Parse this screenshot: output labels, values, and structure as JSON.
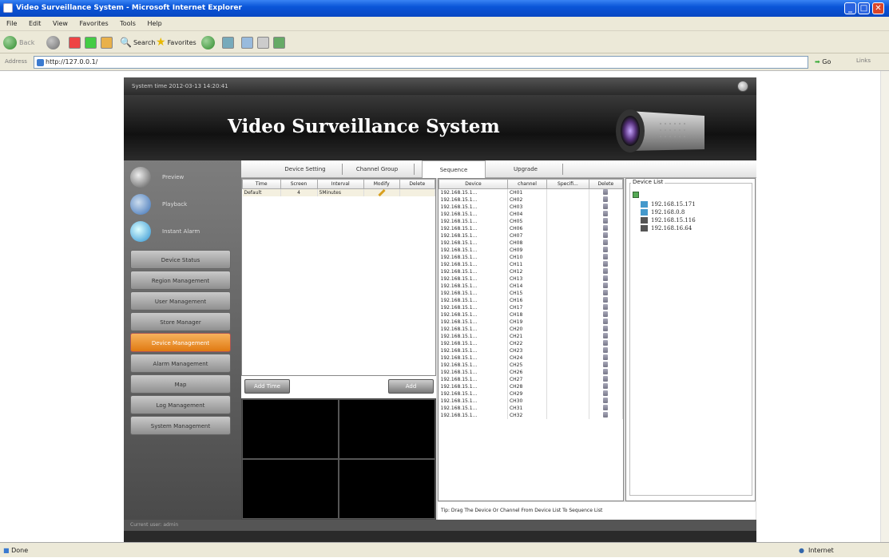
{
  "window": {
    "title": "Video Surveillance System - Microsoft Internet Explorer"
  },
  "menu": {
    "items": [
      "File",
      "Edit",
      "View",
      "Favorites",
      "Tools",
      "Help"
    ]
  },
  "toolbar": {
    "back": "Back",
    "search": "Search",
    "favorites": "Favorites"
  },
  "address": {
    "label": "Address",
    "url": "http://127.0.0.1/",
    "go": "Go",
    "links": "Links"
  },
  "status": {
    "left": "Done",
    "zone": "Internet"
  },
  "app": {
    "system_time": "System time 2012-03-13 14:20:41",
    "banner_title": "Video Surveillance System",
    "nav_top": [
      "Preview",
      "Playback",
      "Instant Alarm"
    ],
    "nav": [
      "Device Status",
      "Region Management",
      "User Management",
      "Store Manager",
      "Device Management",
      "Alarm Management",
      "Map",
      "Log Management",
      "System Management"
    ],
    "nav_active": "Device Management",
    "tabs": [
      "Device Setting",
      "Channel Group",
      "Sequence",
      "Upgrade"
    ],
    "active_tab": "Sequence",
    "seq_table": {
      "headers": [
        "Time",
        "Screen",
        "Interval",
        "Modify",
        "Delete"
      ],
      "rows": [
        [
          "Default",
          "4",
          "5Minutes"
        ]
      ]
    },
    "add_time_label": "Add Time",
    "add_label": "Add",
    "chan_table": {
      "headers": [
        "Device",
        "channel",
        "Specifi...",
        "Delete"
      ],
      "device": "192.168.15.1...",
      "channels": [
        "CH01",
        "CH02",
        "CH03",
        "CH04",
        "CH05",
        "CH06",
        "CH07",
        "CH08",
        "CH09",
        "CH10",
        "CH11",
        "CH12",
        "CH13",
        "CH14",
        "CH15",
        "CH16",
        "CH17",
        "CH18",
        "CH19",
        "CH20",
        "CH21",
        "CH22",
        "CH23",
        "CH24",
        "CH25",
        "CH26",
        "CH27",
        "CH28",
        "CH29",
        "CH30",
        "CH31",
        "CH32"
      ]
    },
    "device_list": {
      "label": "Device List",
      "items": [
        "192.168.15.171",
        "192.168.0.8",
        "192.168.15.116",
        "192.168.16.64"
      ]
    },
    "tip": "Tip: Drag The Device Or Channel From Device List To Sequence List",
    "current_user": "Current user: admin"
  }
}
